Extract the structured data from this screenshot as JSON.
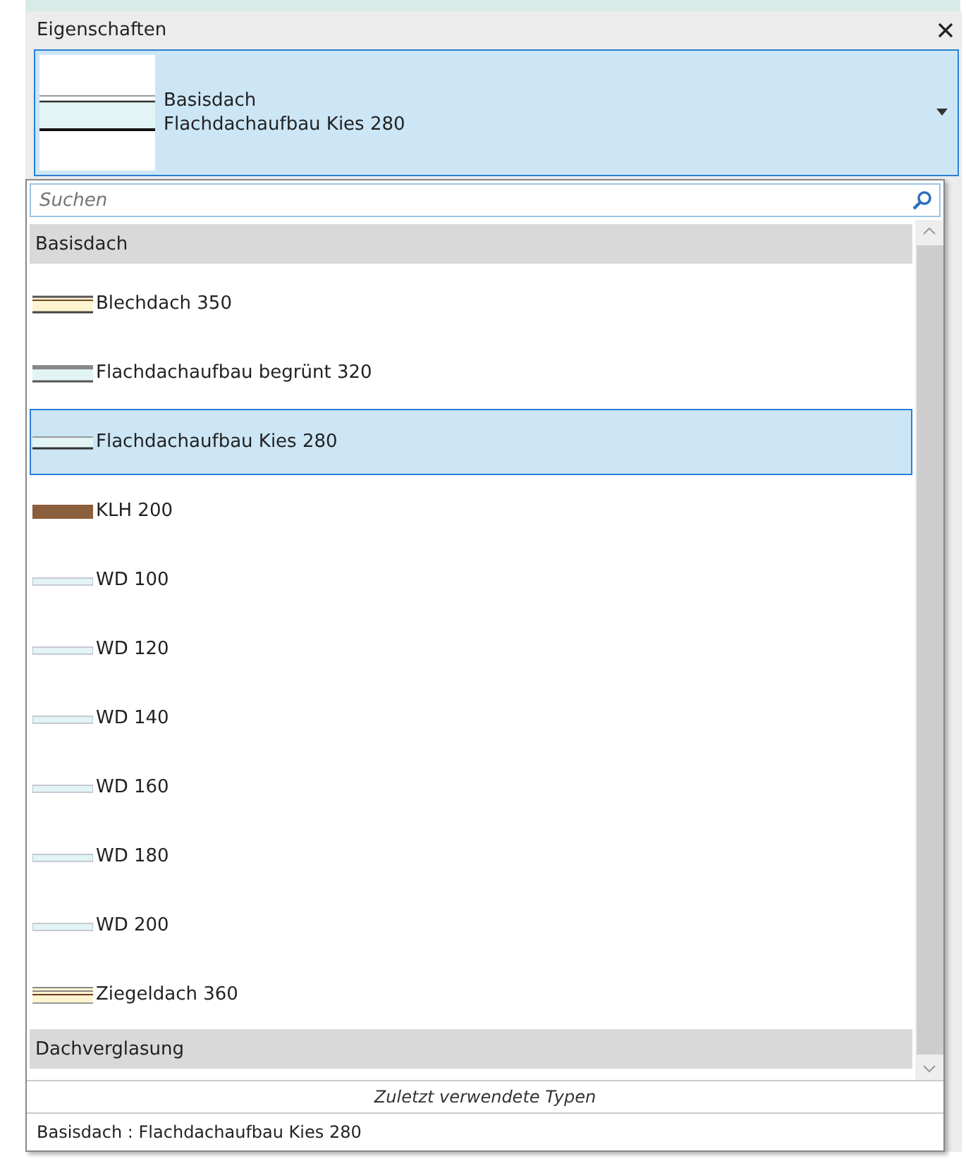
{
  "panel": {
    "title": "Eigenschaften"
  },
  "type_selector": {
    "family": "Basisdach",
    "type": "Flachdachaufbau Kies 280"
  },
  "search": {
    "placeholder": "Suchen"
  },
  "groups": [
    {
      "label": "Basisdach",
      "items": [
        {
          "label": "Blechdach 350",
          "kind": "metal",
          "selected": false
        },
        {
          "label": "Flachdachaufbau begrünt 320",
          "kind": "green",
          "selected": false
        },
        {
          "label": "Flachdachaufbau Kies 280",
          "kind": "gravel",
          "selected": true
        },
        {
          "label": "KLH 200",
          "kind": "timber",
          "selected": false
        },
        {
          "label": "WD 100",
          "kind": "insulation",
          "selected": false
        },
        {
          "label": "WD 120",
          "kind": "insulation",
          "selected": false
        },
        {
          "label": "WD 140",
          "kind": "insulation",
          "selected": false
        },
        {
          "label": "WD 160",
          "kind": "insulation",
          "selected": false
        },
        {
          "label": "WD 180",
          "kind": "insulation",
          "selected": false
        },
        {
          "label": "WD 200",
          "kind": "insulation",
          "selected": false
        },
        {
          "label": "Ziegeldach 360",
          "kind": "tile",
          "selected": false
        }
      ]
    },
    {
      "label": "Dachverglasung"
    }
  ],
  "recent": {
    "heading": "Zuletzt verwendete Typen",
    "items": [
      "Basisdach : Flachdachaufbau Kies 280"
    ]
  }
}
